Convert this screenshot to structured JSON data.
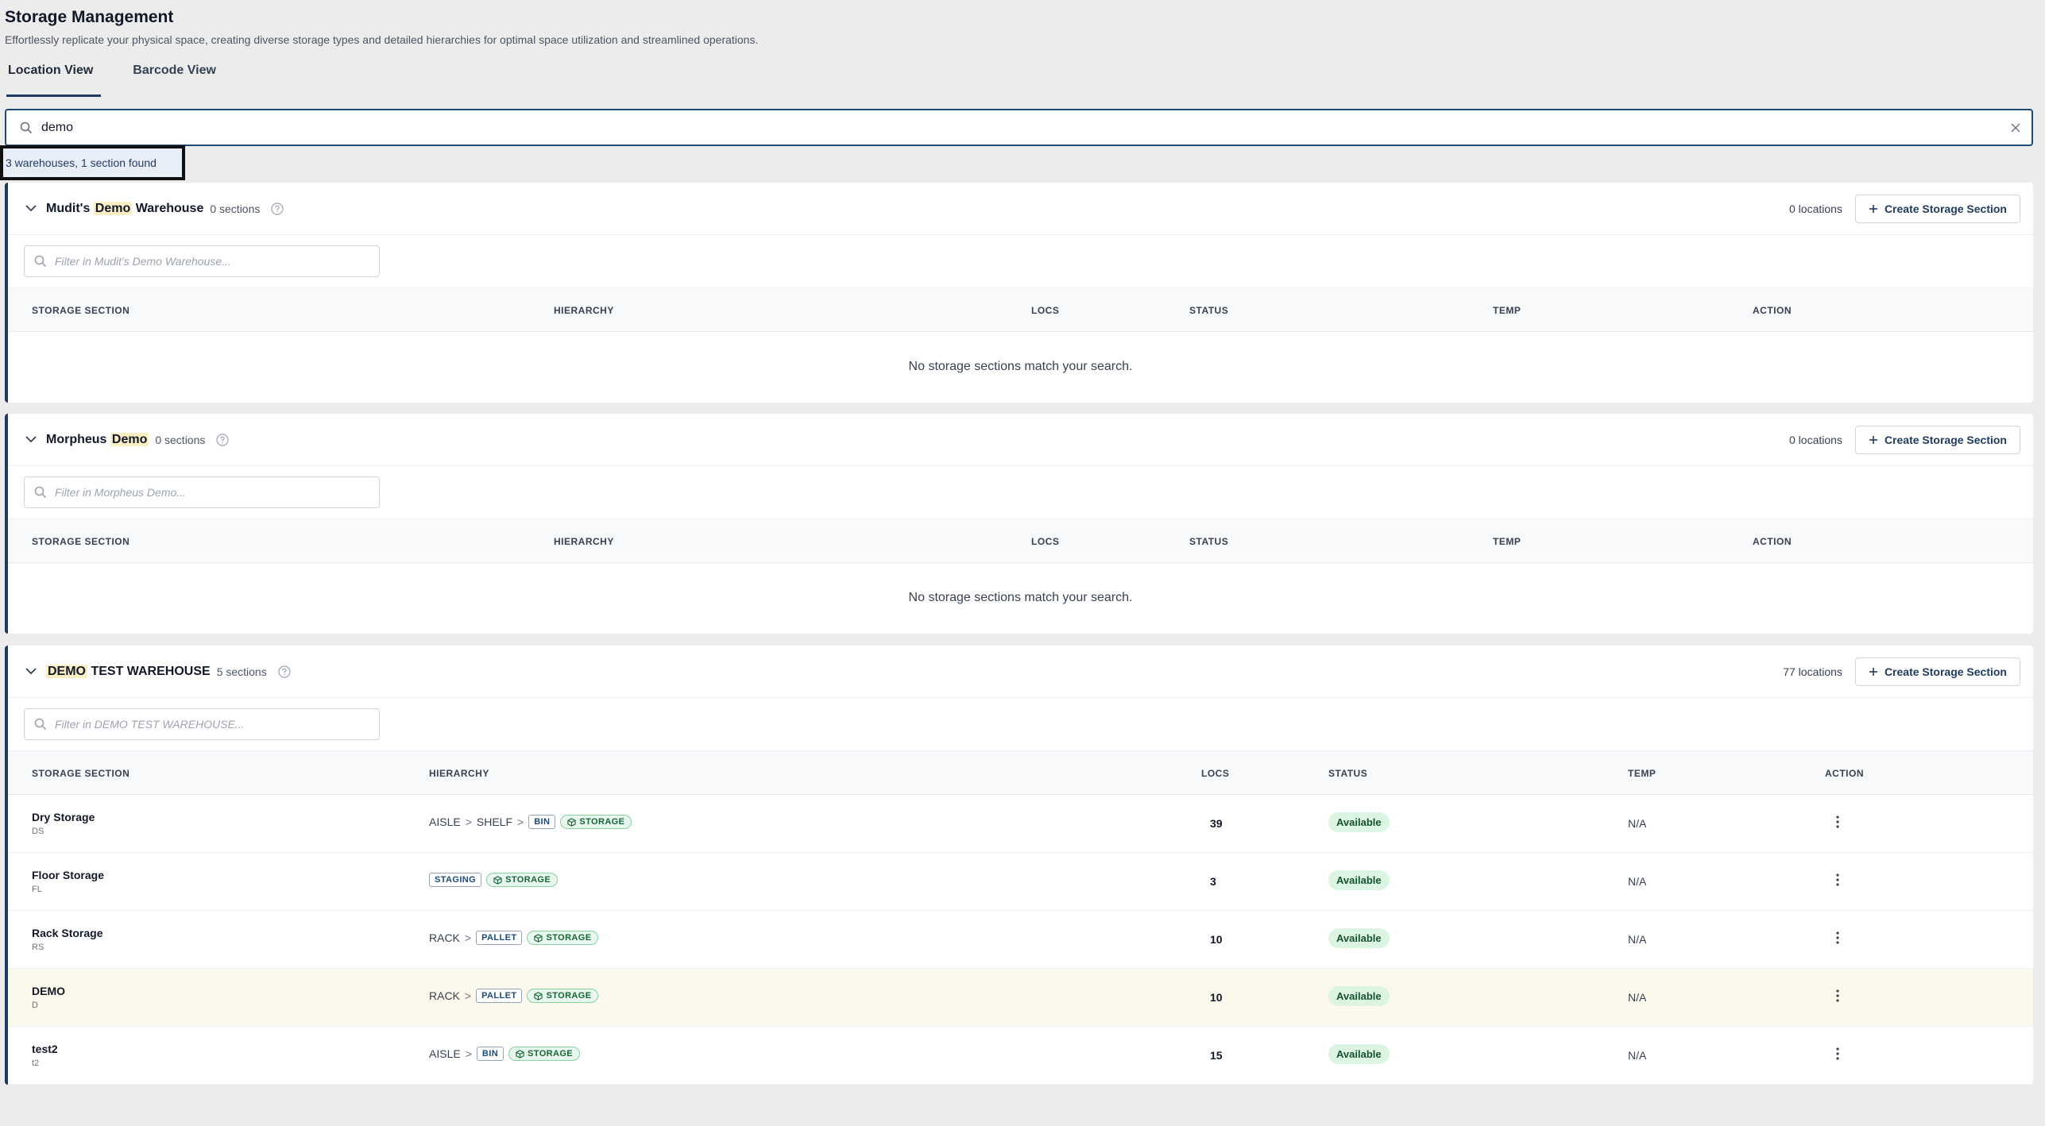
{
  "header": {
    "title": "Storage Management",
    "subtitle": "Effortlessly replicate your physical space, creating diverse storage types and detailed hierarchies for optimal space utilization and streamlined operations."
  },
  "tabs": [
    {
      "label": "Location View",
      "active": true
    },
    {
      "label": "Barcode View",
      "active": false
    }
  ],
  "search": {
    "value": "demo"
  },
  "result_count": "3 warehouses, 1 section found",
  "columns": {
    "storage_section": "STORAGE SECTION",
    "hierarchy": "HIERARCHY",
    "locs": "LOCS",
    "status": "STATUS",
    "temp": "TEMP",
    "action": "ACTION"
  },
  "empty_message": "No storage sections match your search.",
  "create_label": "Create Storage Section",
  "warehouses": [
    {
      "name_before": "Mudit's ",
      "name_highlight": "Demo",
      "name_after": " Warehouse",
      "sections": "0 sections",
      "locations": "0 locations",
      "filter_placeholder": "Filter in Mudit's Demo Warehouse..."
    },
    {
      "name_before": "Morpheus ",
      "name_highlight": "Demo",
      "name_after": "",
      "sections": "0 sections",
      "locations": "0 locations",
      "filter_placeholder": "Filter in Morpheus Demo..."
    },
    {
      "name_before": "",
      "name_highlight": "DEMO",
      "name_after": " TEST WAREHOUSE",
      "sections": "5 sections",
      "locations": "77 locations",
      "filter_placeholder": "Filter in DEMO TEST WAREHOUSE...",
      "rows": [
        {
          "name": "Dry Storage",
          "code": "DS",
          "hierarchy": [
            "AISLE",
            "SHELF"
          ],
          "tag": "BIN",
          "type": "STORAGE",
          "locs": "39",
          "status": "Available",
          "temp": "N/A"
        },
        {
          "name": "Floor Storage",
          "code": "FL",
          "hierarchy": [],
          "tag": "STAGING",
          "type": "STORAGE",
          "locs": "3",
          "status": "Available",
          "temp": "N/A"
        },
        {
          "name": "Rack Storage",
          "code": "RS",
          "hierarchy": [
            "RACK"
          ],
          "tag": "PALLET",
          "type": "STORAGE",
          "locs": "10",
          "status": "Available",
          "temp": "N/A"
        },
        {
          "name": "DEMO",
          "code": "D",
          "hierarchy": [
            "RACK"
          ],
          "tag": "PALLET",
          "type": "STORAGE",
          "locs": "10",
          "status": "Available",
          "temp": "N/A"
        },
        {
          "name": "test2",
          "code": "t2",
          "hierarchy": [
            "AISLE"
          ],
          "tag": "BIN",
          "type": "STORAGE",
          "locs": "15",
          "status": "Available",
          "temp": "N/A"
        }
      ]
    }
  ],
  "hierarchy_separator": ">",
  "colors": {
    "accent": "#1e3a5f",
    "highlight": "#fbeec4",
    "status_bg": "#dcf5e3"
  }
}
